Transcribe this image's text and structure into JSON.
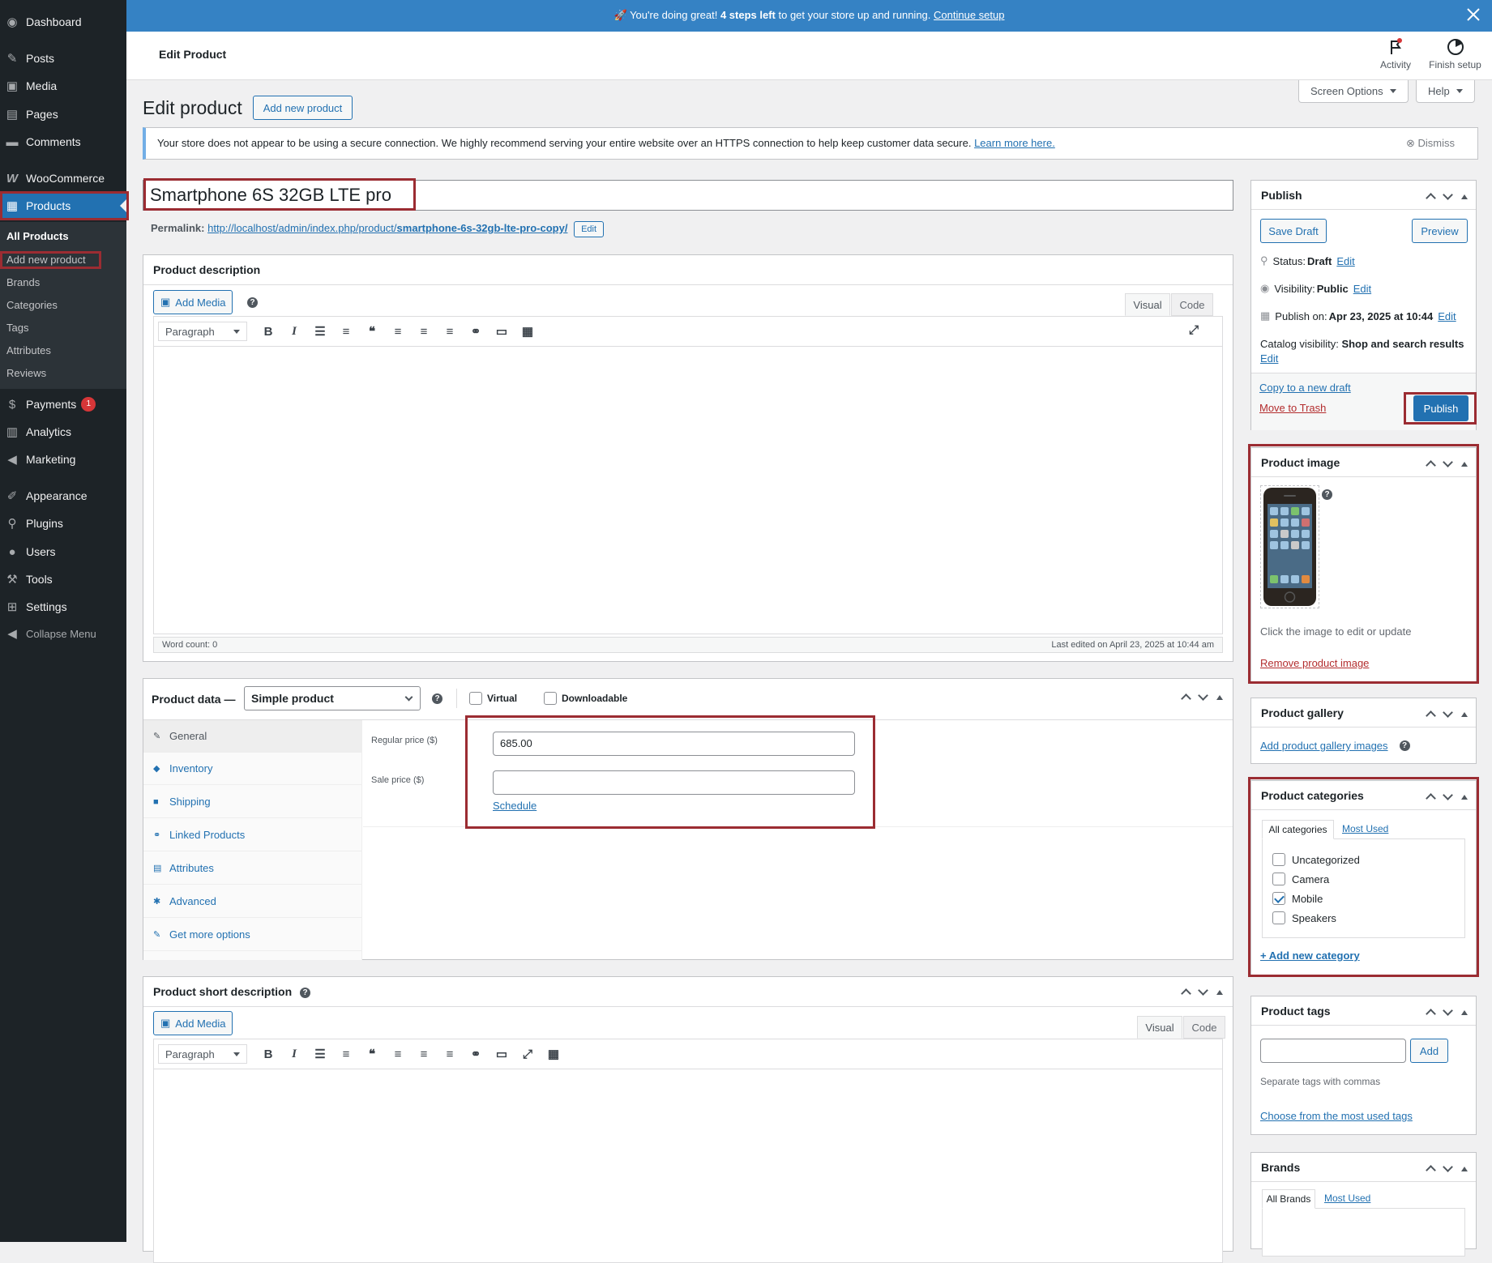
{
  "sidebar": {
    "dashboard": "Dashboard",
    "posts": "Posts",
    "media": "Media",
    "pages": "Pages",
    "comments": "Comments",
    "woocommerce": "WooCommerce",
    "products": "Products",
    "sub": {
      "all_products": "All Products",
      "add_new": "Add new product",
      "brands": "Brands",
      "categories": "Categories",
      "tags": "Tags",
      "attributes": "Attributes",
      "reviews": "Reviews"
    },
    "payments": "Payments",
    "payments_badge": "1",
    "analytics": "Analytics",
    "marketing": "Marketing",
    "appearance": "Appearance",
    "plugins": "Plugins",
    "users": "Users",
    "tools": "Tools",
    "settings": "Settings",
    "collapse": "Collapse Menu"
  },
  "banner": {
    "prefix": "🚀 You're doing great! ",
    "bold": "4 steps left",
    "middle": " to get your store up and running. ",
    "link": "Continue setup"
  },
  "header": {
    "title": "Edit Product",
    "activity": "Activity",
    "finish_setup": "Finish setup"
  },
  "screen_options": "Screen Options",
  "help": "Help",
  "page_title": "Edit product",
  "add_new_button": "Add new product",
  "notice": {
    "text": "Your store does not appear to be using a secure connection. We highly recommend serving your entire website over an HTTPS connection to help keep customer data secure. ",
    "link": "Learn more here.",
    "dismiss": "Dismiss"
  },
  "product_title": "Smartphone 6S 32GB LTE pro",
  "permalink": {
    "label": "Permalink:",
    "base": "http://localhost/admin/index.php/product/",
    "slug": "smartphone-6s-32gb-lte-pro-copy/",
    "edit": "Edit"
  },
  "description": {
    "title": "Product description",
    "add_media": "Add Media",
    "tab_visual": "Visual",
    "tab_code": "Code",
    "format": "Paragraph",
    "word_count": "Word count: 0",
    "last_edited": "Last edited on April 23, 2025 at 10:44 am"
  },
  "product_data": {
    "title": "Product data —",
    "type": "Simple product",
    "virtual": "Virtual",
    "downloadable": "Downloadable",
    "tabs": [
      "General",
      "Inventory",
      "Shipping",
      "Linked Products",
      "Attributes",
      "Advanced",
      "Get more options"
    ],
    "regular_price_label": "Regular price ($)",
    "regular_price": "685.00",
    "sale_price_label": "Sale price ($)",
    "sale_price": "",
    "schedule": "Schedule"
  },
  "short_description": {
    "title": "Product short description",
    "add_media": "Add Media",
    "tab_visual": "Visual",
    "tab_code": "Code",
    "format": "Paragraph"
  },
  "publish": {
    "title": "Publish",
    "save_draft": "Save Draft",
    "preview": "Preview",
    "status_label": "Status: ",
    "status": "Draft",
    "visibility_label": "Visibility: ",
    "visibility": "Public",
    "publish_on_label": "Publish on: ",
    "publish_on": "Apr 23, 2025 at 10:44",
    "catalog_label": "Catalog visibility: ",
    "catalog": "Shop and search results",
    "edit": "Edit",
    "copy_draft": "Copy to a new draft",
    "trash": "Move to Trash",
    "publish_button": "Publish"
  },
  "product_image": {
    "title": "Product image",
    "hint": "Click the image to edit or update",
    "remove": "Remove product image"
  },
  "gallery": {
    "title": "Product gallery",
    "add": "Add product gallery images"
  },
  "categories": {
    "title": "Product categories",
    "tab_all": "All categories",
    "tab_most": "Most Used",
    "items": [
      {
        "name": "Uncategorized",
        "checked": false
      },
      {
        "name": "Camera",
        "checked": false
      },
      {
        "name": "Mobile",
        "checked": true
      },
      {
        "name": "Speakers",
        "checked": false
      }
    ],
    "add_new": "+ Add new category"
  },
  "tags": {
    "title": "Product tags",
    "add": "Add",
    "hint": "Separate tags with commas",
    "choose": "Choose from the most used tags"
  },
  "brands": {
    "title": "Brands",
    "tab_all": "All Brands",
    "tab_most": "Most Used"
  },
  "colors": {
    "sidebar_bg": "#1d2327",
    "accent": "#2271b1",
    "banner": "#3582c4",
    "highlight": "#9b2c32"
  }
}
